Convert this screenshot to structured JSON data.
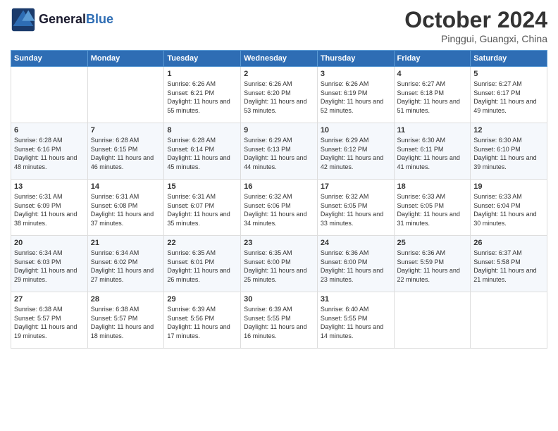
{
  "header": {
    "logo_line1": "General",
    "logo_line2": "Blue",
    "month": "October 2024",
    "location": "Pinggui, Guangxi, China"
  },
  "days_of_week": [
    "Sunday",
    "Monday",
    "Tuesday",
    "Wednesday",
    "Thursday",
    "Friday",
    "Saturday"
  ],
  "weeks": [
    [
      {
        "day": "",
        "info": ""
      },
      {
        "day": "",
        "info": ""
      },
      {
        "day": "1",
        "sunrise": "6:26 AM",
        "sunset": "6:21 PM",
        "daylight": "11 hours and 55 minutes."
      },
      {
        "day": "2",
        "sunrise": "6:26 AM",
        "sunset": "6:20 PM",
        "daylight": "11 hours and 53 minutes."
      },
      {
        "day": "3",
        "sunrise": "6:26 AM",
        "sunset": "6:19 PM",
        "daylight": "11 hours and 52 minutes."
      },
      {
        "day": "4",
        "sunrise": "6:27 AM",
        "sunset": "6:18 PM",
        "daylight": "11 hours and 51 minutes."
      },
      {
        "day": "5",
        "sunrise": "6:27 AM",
        "sunset": "6:17 PM",
        "daylight": "11 hours and 49 minutes."
      }
    ],
    [
      {
        "day": "6",
        "sunrise": "6:28 AM",
        "sunset": "6:16 PM",
        "daylight": "11 hours and 48 minutes."
      },
      {
        "day": "7",
        "sunrise": "6:28 AM",
        "sunset": "6:15 PM",
        "daylight": "11 hours and 46 minutes."
      },
      {
        "day": "8",
        "sunrise": "6:28 AM",
        "sunset": "6:14 PM",
        "daylight": "11 hours and 45 minutes."
      },
      {
        "day": "9",
        "sunrise": "6:29 AM",
        "sunset": "6:13 PM",
        "daylight": "11 hours and 44 minutes."
      },
      {
        "day": "10",
        "sunrise": "6:29 AM",
        "sunset": "6:12 PM",
        "daylight": "11 hours and 42 minutes."
      },
      {
        "day": "11",
        "sunrise": "6:30 AM",
        "sunset": "6:11 PM",
        "daylight": "11 hours and 41 minutes."
      },
      {
        "day": "12",
        "sunrise": "6:30 AM",
        "sunset": "6:10 PM",
        "daylight": "11 hours and 39 minutes."
      }
    ],
    [
      {
        "day": "13",
        "sunrise": "6:31 AM",
        "sunset": "6:09 PM",
        "daylight": "11 hours and 38 minutes."
      },
      {
        "day": "14",
        "sunrise": "6:31 AM",
        "sunset": "6:08 PM",
        "daylight": "11 hours and 37 minutes."
      },
      {
        "day": "15",
        "sunrise": "6:31 AM",
        "sunset": "6:07 PM",
        "daylight": "11 hours and 35 minutes."
      },
      {
        "day": "16",
        "sunrise": "6:32 AM",
        "sunset": "6:06 PM",
        "daylight": "11 hours and 34 minutes."
      },
      {
        "day": "17",
        "sunrise": "6:32 AM",
        "sunset": "6:05 PM",
        "daylight": "11 hours and 33 minutes."
      },
      {
        "day": "18",
        "sunrise": "6:33 AM",
        "sunset": "6:05 PM",
        "daylight": "11 hours and 31 minutes."
      },
      {
        "day": "19",
        "sunrise": "6:33 AM",
        "sunset": "6:04 PM",
        "daylight": "11 hours and 30 minutes."
      }
    ],
    [
      {
        "day": "20",
        "sunrise": "6:34 AM",
        "sunset": "6:03 PM",
        "daylight": "11 hours and 29 minutes."
      },
      {
        "day": "21",
        "sunrise": "6:34 AM",
        "sunset": "6:02 PM",
        "daylight": "11 hours and 27 minutes."
      },
      {
        "day": "22",
        "sunrise": "6:35 AM",
        "sunset": "6:01 PM",
        "daylight": "11 hours and 26 minutes."
      },
      {
        "day": "23",
        "sunrise": "6:35 AM",
        "sunset": "6:00 PM",
        "daylight": "11 hours and 25 minutes."
      },
      {
        "day": "24",
        "sunrise": "6:36 AM",
        "sunset": "6:00 PM",
        "daylight": "11 hours and 23 minutes."
      },
      {
        "day": "25",
        "sunrise": "6:36 AM",
        "sunset": "5:59 PM",
        "daylight": "11 hours and 22 minutes."
      },
      {
        "day": "26",
        "sunrise": "6:37 AM",
        "sunset": "5:58 PM",
        "daylight": "11 hours and 21 minutes."
      }
    ],
    [
      {
        "day": "27",
        "sunrise": "6:38 AM",
        "sunset": "5:57 PM",
        "daylight": "11 hours and 19 minutes."
      },
      {
        "day": "28",
        "sunrise": "6:38 AM",
        "sunset": "5:57 PM",
        "daylight": "11 hours and 18 minutes."
      },
      {
        "day": "29",
        "sunrise": "6:39 AM",
        "sunset": "5:56 PM",
        "daylight": "11 hours and 17 minutes."
      },
      {
        "day": "30",
        "sunrise": "6:39 AM",
        "sunset": "5:55 PM",
        "daylight": "11 hours and 16 minutes."
      },
      {
        "day": "31",
        "sunrise": "6:40 AM",
        "sunset": "5:55 PM",
        "daylight": "11 hours and 14 minutes."
      },
      {
        "day": "",
        "info": ""
      },
      {
        "day": "",
        "info": ""
      }
    ]
  ]
}
